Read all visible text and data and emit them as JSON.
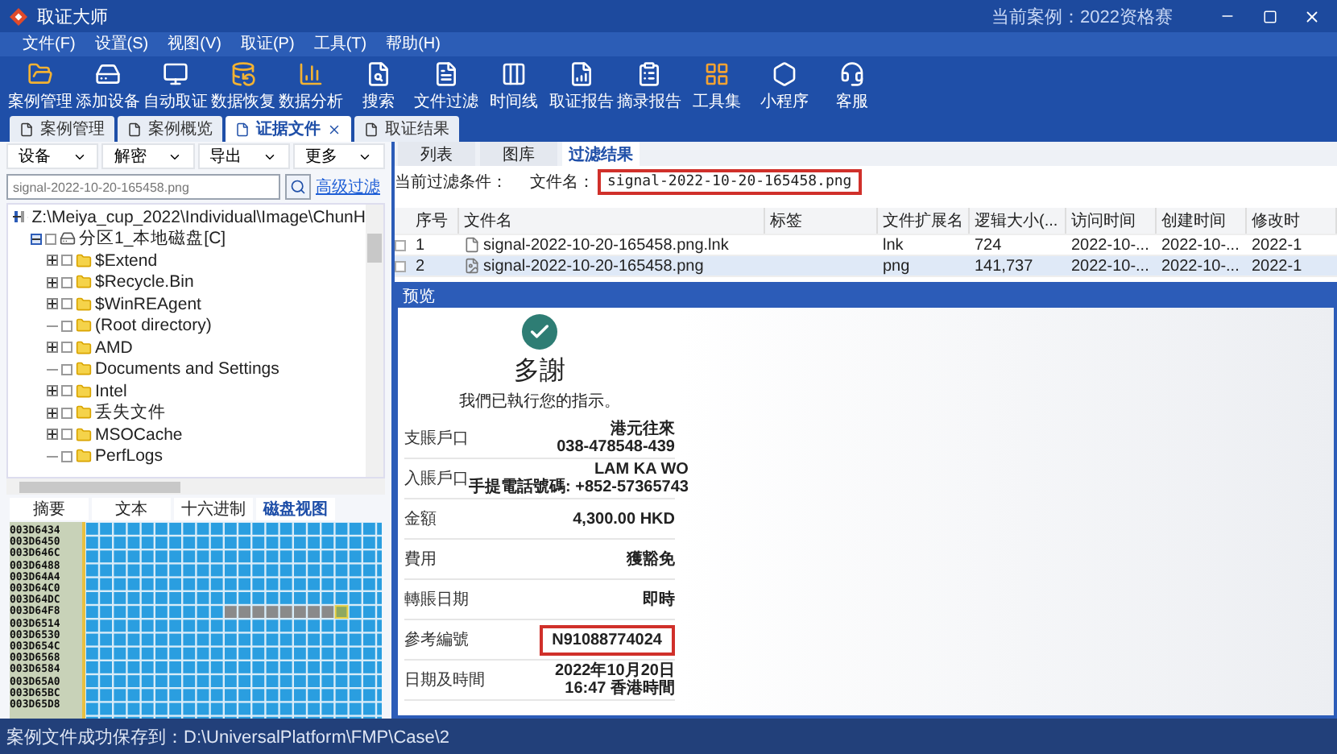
{
  "window": {
    "title": "取证大师",
    "current_case": "当前案例：2022资格赛"
  },
  "menu": [
    "文件(F)",
    "设置(S)",
    "视图(V)",
    "取证(P)",
    "工具(T)",
    "帮助(H)"
  ],
  "toolbar": [
    "案例管理",
    "添加设备",
    "自动取证",
    "数据恢复",
    "数据分析",
    "搜索",
    "文件过滤",
    "时间线",
    "取证报告",
    "摘录报告",
    "工具集",
    "小程序",
    "客服"
  ],
  "tabs": [
    {
      "label": "案例管理",
      "selected": false,
      "closable": false
    },
    {
      "label": "案例概览",
      "selected": false,
      "closable": false
    },
    {
      "label": "证据文件",
      "selected": true,
      "closable": true
    },
    {
      "label": "取证结果",
      "selected": false,
      "closable": false
    }
  ],
  "left_panel": {
    "actions": [
      "设备",
      "解密",
      "导出",
      "更多"
    ],
    "search": {
      "value": "signal-2022-10-20-165458.png"
    },
    "advanced_filter": "高级过滤",
    "tree": [
      {
        "label": "Z:\\Meiya_cup_2022\\Individual\\Image\\ChunH",
        "kind": "disk",
        "checked": false,
        "expandable": true,
        "expanded": true,
        "children": [
          {
            "label": "分区1_本地磁盘[C]",
            "kind": "partition",
            "checked": false,
            "expandable": true,
            "expanded": true,
            "children": [
              {
                "label": "$Extend",
                "kind": "folder",
                "checked": false,
                "expandable": true,
                "expanded": false
              },
              {
                "label": "$Recycle.Bin",
                "kind": "folder",
                "checked": false,
                "expandable": true,
                "expanded": false
              },
              {
                "label": "$WinREAgent",
                "kind": "folder",
                "checked": false,
                "expandable": true,
                "expanded": false
              },
              {
                "label": "(Root directory)",
                "kind": "folder",
                "checked": false,
                "expandable": false
              },
              {
                "label": "AMD",
                "kind": "folder",
                "checked": false,
                "expandable": true,
                "expanded": false
              },
              {
                "label": "Documents and Settings",
                "kind": "folder",
                "checked": false,
                "expandable": false
              },
              {
                "label": "Intel",
                "kind": "folder",
                "checked": false,
                "expandable": true,
                "expanded": false
              },
              {
                "label": "丢失文件",
                "kind": "folder",
                "checked": false,
                "expandable": true,
                "expanded": false
              },
              {
                "label": "MSOCache",
                "kind": "folder",
                "checked": false,
                "expandable": true,
                "expanded": false
              },
              {
                "label": "PerfLogs",
                "kind": "folder",
                "checked": false,
                "expandable": false
              }
            ]
          }
        ]
      }
    ],
    "bottom_tabs": [
      {
        "label": "摘要",
        "selected": false
      },
      {
        "label": "文本",
        "selected": false
      },
      {
        "label": "十六进制",
        "selected": false
      },
      {
        "label": "磁盘视图",
        "selected": true
      }
    ],
    "disk_view": {
      "addresses": [
        "003D6434",
        "003D6450",
        "003D646C",
        "003D6488",
        "003D64A4",
        "003D64C0",
        "003D64DC",
        "003D64F8",
        "003D6514",
        "003D6530",
        "003D654C",
        "003D6568",
        "003D6584",
        "003D65A0",
        "003D65BC",
        "003D65D8"
      ]
    }
  },
  "right_panel": {
    "tabs": [
      {
        "label": "列表",
        "selected": false
      },
      {
        "label": "图库",
        "selected": false
      },
      {
        "label": "过滤结果",
        "selected": true
      }
    ],
    "filter": {
      "label": "当前过滤条件：",
      "field": "文件名：",
      "value": "signal-2022-10-20-165458.png",
      "highlighted": true
    },
    "table": {
      "columns": [
        "序号",
        "文件名",
        "标签",
        "文件扩展名",
        "逻辑大小(...",
        "访问时间",
        "创建时间",
        "修改时"
      ],
      "rows": [
        {
          "selected": false,
          "checked": false,
          "cells": [
            "1",
            "signal-2022-10-20-165458.png.lnk",
            "",
            "lnk",
            "724",
            "2022-10-...",
            "2022-10-...",
            "2022-1"
          ]
        },
        {
          "selected": true,
          "checked": false,
          "cells": [
            "2",
            "signal-2022-10-20-165458.png",
            "",
            "png",
            "141,737",
            "2022-10-...",
            "2022-10-...",
            "2022-1"
          ]
        }
      ]
    },
    "preview": {
      "title": "预览",
      "heading": "多謝",
      "message": "我們已執行您的指示。",
      "rows": [
        {
          "label": "支賬戶口",
          "value": [
            "港元往來",
            "038-478548-439"
          ],
          "highlighted": false
        },
        {
          "label": "入賬戶口",
          "value": [
            "LAM KA WO",
            "手提電話號碼: +852-57365743"
          ],
          "highlighted": false
        },
        {
          "label": "金額",
          "value": [
            "4,300.00 HKD"
          ],
          "highlighted": false
        },
        {
          "label": "費用",
          "value": [
            "獲豁免"
          ],
          "highlighted": false
        },
        {
          "label": "轉賬日期",
          "value": [
            "即時"
          ],
          "highlighted": false
        },
        {
          "label": "參考編號",
          "value": [
            "N91088774024"
          ],
          "highlighted": true
        },
        {
          "label": "日期及時間",
          "value": [
            "2022年10月20日",
            "16:47 香港時間"
          ],
          "highlighted": false
        }
      ]
    }
  },
  "status_bar": "案例文件成功保存到：D:\\UniversalPlatform\\FMP\\Case\\2"
}
